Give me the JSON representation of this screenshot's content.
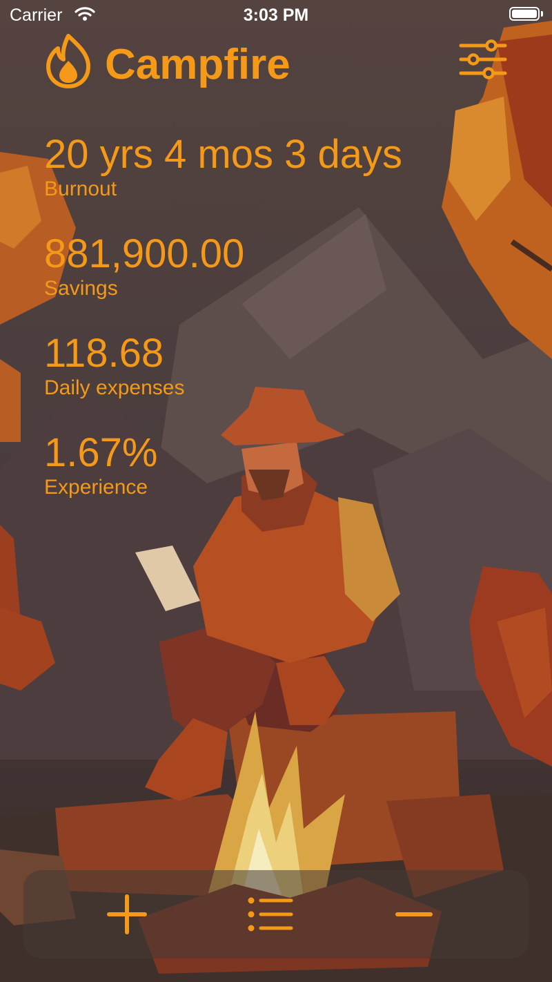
{
  "status_bar": {
    "carrier": "Carrier",
    "time": "3:03 PM"
  },
  "app": {
    "title": "Campfire"
  },
  "stats": [
    {
      "value": "20 yrs 4 mos 3 days",
      "label": "Burnout"
    },
    {
      "value": "881,900.00",
      "label": "Savings"
    },
    {
      "value": "118.68",
      "label": "Daily expenses"
    },
    {
      "value": "1.67%",
      "label": "Experience"
    }
  ],
  "toolbar": {
    "buttons": [
      {
        "icon": "plus-icon"
      },
      {
        "icon": "list-icon"
      },
      {
        "icon": "minus-icon"
      }
    ]
  },
  "colors": {
    "accent": "#F59A18",
    "background": "#3A2E2E",
    "tabbar": "#463A34"
  }
}
